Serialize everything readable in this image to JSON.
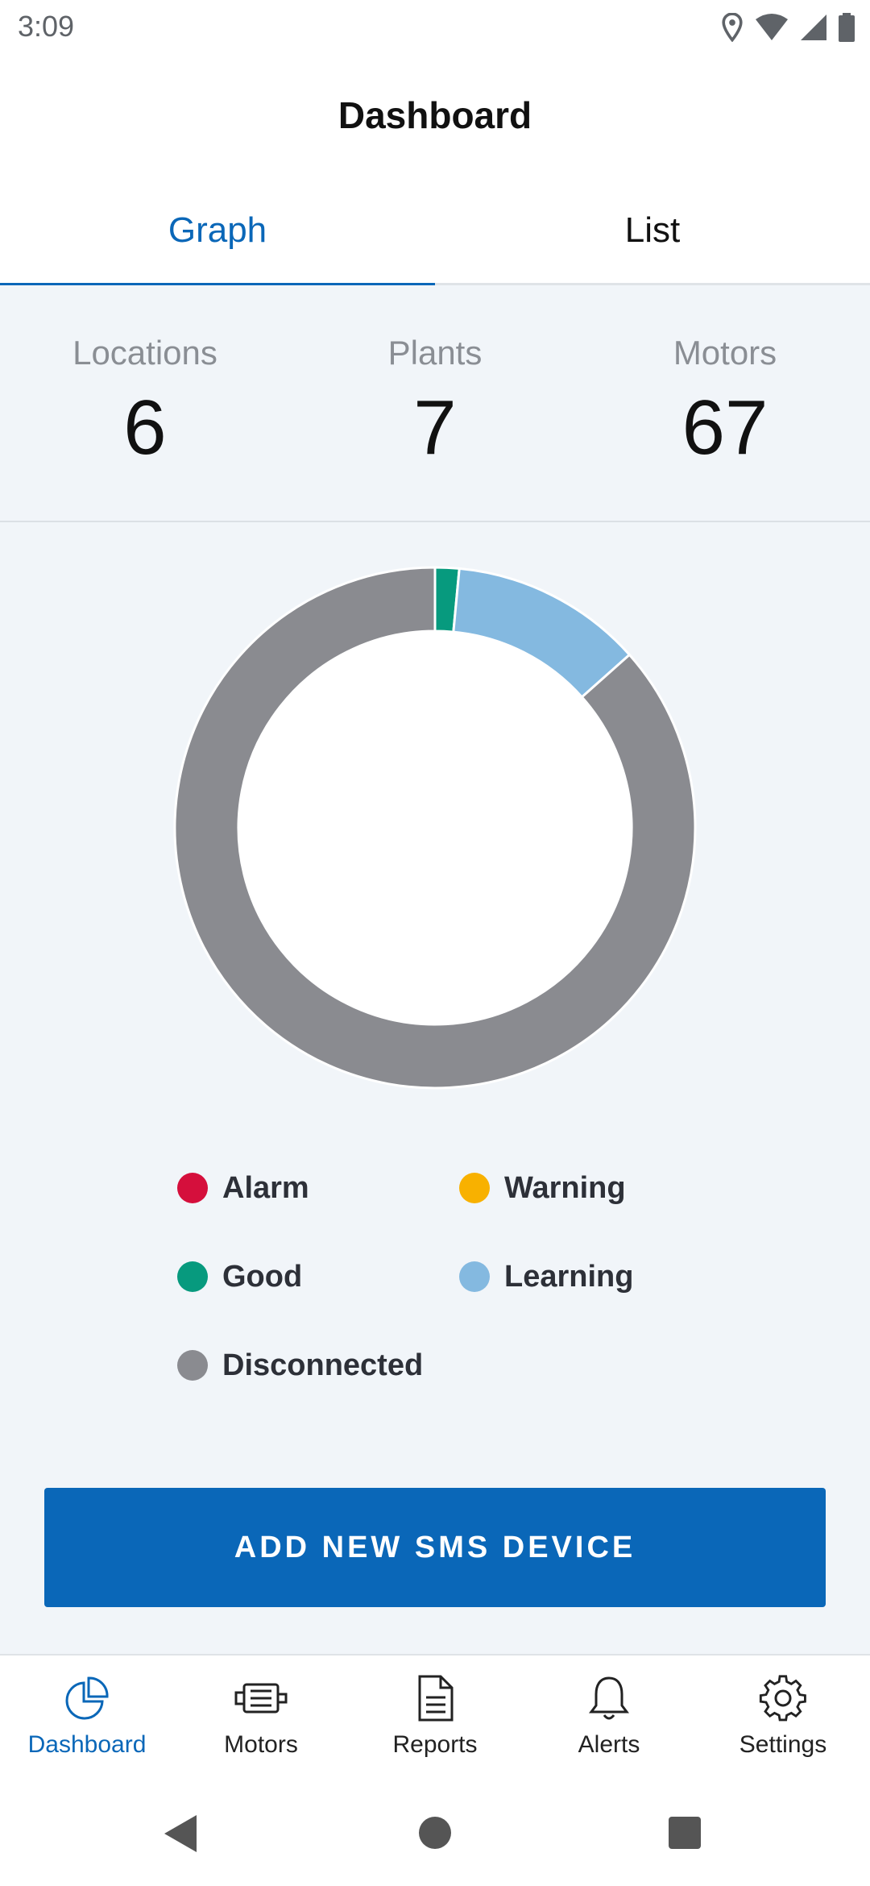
{
  "status_bar": {
    "time": "3:09",
    "icons": [
      "location-icon",
      "wifi-icon",
      "signal-icon",
      "battery-icon"
    ]
  },
  "header": {
    "title": "Dashboard"
  },
  "tabs": [
    {
      "label": "Graph",
      "active": true
    },
    {
      "label": "List",
      "active": false
    }
  ],
  "stats": [
    {
      "label": "Locations",
      "value": "6"
    },
    {
      "label": "Plants",
      "value": "7"
    },
    {
      "label": "Motors",
      "value": "67"
    }
  ],
  "chart_data": {
    "type": "pie",
    "donut": true,
    "categories": [
      "Alarm",
      "Warning",
      "Good",
      "Learning",
      "Disconnected"
    ],
    "values": [
      0,
      0,
      1,
      8,
      58
    ],
    "colors": [
      "#d50f3c",
      "#f8b100",
      "#079a7e",
      "#84b9e0",
      "#8a8b90"
    ]
  },
  "legend": [
    {
      "label": "Alarm",
      "color": "#d50f3c"
    },
    {
      "label": "Warning",
      "color": "#f8b100"
    },
    {
      "label": "Good",
      "color": "#079a7e"
    },
    {
      "label": "Learning",
      "color": "#84b9e0"
    },
    {
      "label": "Disconnected",
      "color": "#8a8b90"
    }
  ],
  "actions": {
    "add_device_label": "ADD NEW SMS DEVICE"
  },
  "bottom_nav": [
    {
      "label": "Dashboard",
      "icon": "dashboard-pie-icon",
      "active": true
    },
    {
      "label": "Motors",
      "icon": "motor-icon",
      "active": false
    },
    {
      "label": "Reports",
      "icon": "report-document-icon",
      "active": false
    },
    {
      "label": "Alerts",
      "icon": "bell-icon",
      "active": false
    },
    {
      "label": "Settings",
      "icon": "gear-icon",
      "active": false
    }
  ],
  "colors": {
    "accent": "#0a67b8",
    "background": "#f1f5f9"
  }
}
